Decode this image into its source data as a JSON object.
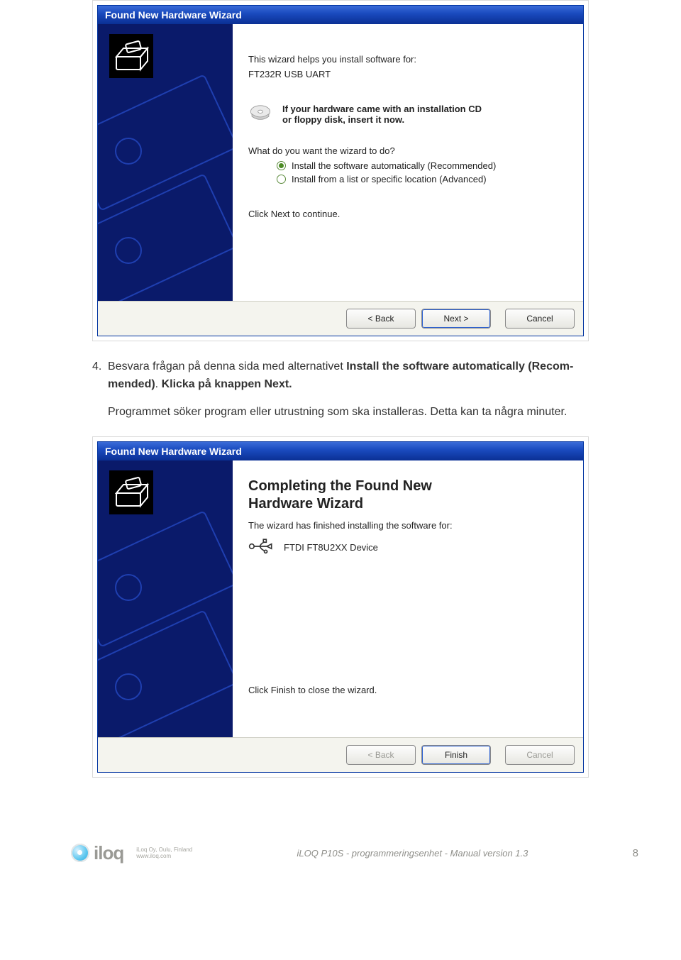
{
  "wizard1": {
    "title": "Found New Hardware Wizard",
    "intro_line": "This wizard helps you install software for:",
    "device_name": "FT232R USB UART",
    "cd_hint_line1": "If your hardware came with an installation CD",
    "cd_hint_line2": "or floppy disk, insert it now.",
    "question": "What do you want the wizard to do?",
    "option_auto": "Install the software automatically (Recommended)",
    "option_list": "Install from a list or specific location (Advanced)",
    "next_hint": "Click Next to continue.",
    "btn_back": "< Back",
    "btn_next": "Next >",
    "btn_cancel": "Cancel"
  },
  "body": {
    "item_number": "4.",
    "line1_a": "Besvara frågan på denna sida med alternativet ",
    "line1_b": "Install the software automatically (Recom-",
    "line2_a": "mended)",
    "line2_b": ". ",
    "line2_c": "Klicka på knappen Next.",
    "para2": "Programmet söker program eller utrustning som ska installeras. Detta kan ta några minuter."
  },
  "wizard2": {
    "title": "Found New Hardware Wizard",
    "heading_l1": "Completing the Found New",
    "heading_l2": "Hardware Wizard",
    "finished_line": "The wizard has finished installing the software for:",
    "device_name": "FTDI FT8U2XX Device",
    "finish_hint": "Click Finish to close the wizard.",
    "btn_back": "< Back",
    "btn_finish": "Finish",
    "btn_cancel": "Cancel"
  },
  "footer": {
    "logo_text": "iloq",
    "addr_l1": "iLoq Oy, Oulu, Finland",
    "addr_l2": "www.iloq.com",
    "center": "iLOQ P10S - programmeringsenhet - Manual version 1.3",
    "page": "8"
  }
}
